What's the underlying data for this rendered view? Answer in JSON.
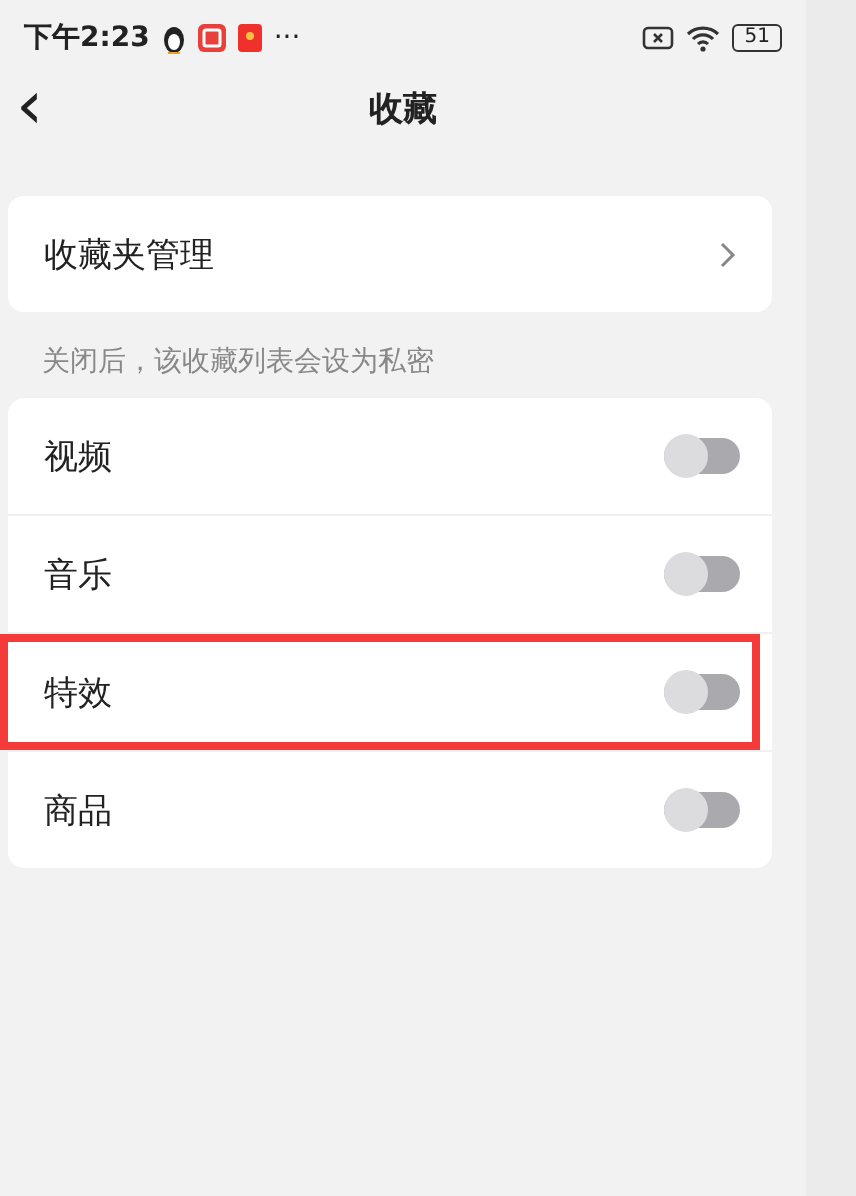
{
  "status_bar": {
    "time": "下午2:23",
    "more": "···",
    "battery": "51"
  },
  "header": {
    "back": "‹",
    "title": "收藏"
  },
  "folder_manage": {
    "label": "收藏夹管理"
  },
  "privacy_note": "关闭后，该收藏列表会设为私密",
  "toggles": [
    {
      "label": "视频",
      "on": false,
      "highlighted": false
    },
    {
      "label": "音乐",
      "on": false,
      "highlighted": false
    },
    {
      "label": "特效",
      "on": false,
      "highlighted": true
    },
    {
      "label": "商品",
      "on": false,
      "highlighted": false
    }
  ]
}
